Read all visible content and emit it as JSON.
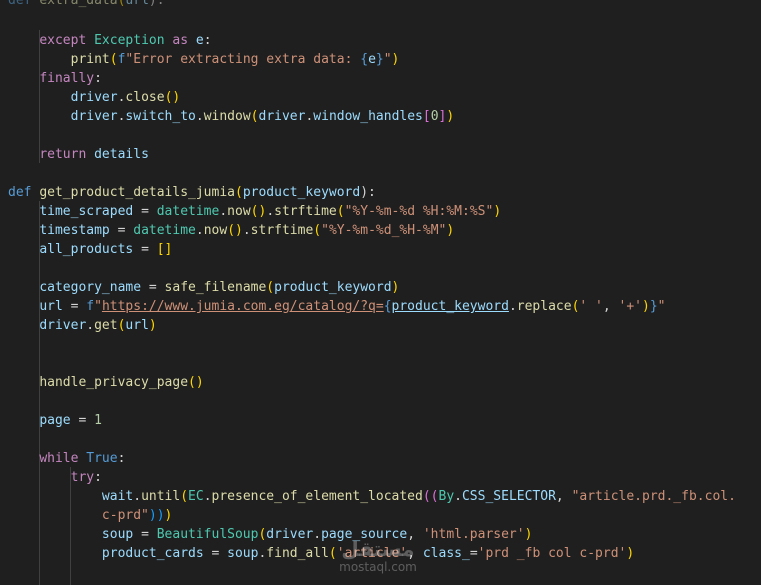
{
  "colors": {
    "background": "#1f1f1f",
    "control_keyword": "#c586c0",
    "keyword": "#569cd6",
    "function": "#dcdcaa",
    "variable": "#9cdcfe",
    "class": "#4ec9b0",
    "string": "#ce9178",
    "number": "#b5cea8"
  },
  "code": {
    "l0": {
      "def": "def",
      "name": "extra_data",
      "param": "url",
      "tail": "):"
    },
    "l2": {
      "except": "except",
      "cls": "Exception",
      "as": "as",
      "var": "e",
      "colon": ":"
    },
    "l3": {
      "fn": "print",
      "pre": "f",
      "str1": "\"Error extracting extra data: ",
      "var": "e",
      "str2": "\""
    },
    "l4": {
      "kw": "finally",
      "colon": ":"
    },
    "l5": {
      "obj": "driver",
      "method": "close"
    },
    "l6": {
      "obj": "driver",
      "attr": "switch_to",
      "method": "window",
      "obj2": "driver",
      "attr2": "window_handles",
      "idx": "0"
    },
    "l8": {
      "kw": "return",
      "var": "details"
    },
    "l10": {
      "def": "def",
      "name": "get_product_details_jumia",
      "param": "product_keyword",
      "tail": "):"
    },
    "l11": {
      "var": "time_scraped",
      "mod": "datetime",
      "fn1": "now",
      "fn2": "strftime",
      "str": "\"%Y-%m-%d %H:%M:%S\""
    },
    "l12": {
      "var": "timestamp",
      "mod": "datetime",
      "fn1": "now",
      "fn2": "strftime",
      "str": "\"%Y-%m-%d_%H-%M\""
    },
    "l13": {
      "var": "all_products",
      "val": "[]"
    },
    "l15": {
      "var": "category_name",
      "fn": "safe_filename",
      "arg": "product_keyword"
    },
    "l16": {
      "var": "url",
      "pre": "f",
      "quote": "\"",
      "link": "https://www.jumia.com.eg/catalog/?q=",
      "arg": "product_keyword",
      "method": "replace",
      "s1": "' '",
      "s2": "'+'",
      "end": "\""
    },
    "l17": {
      "obj": "driver",
      "method": "get",
      "arg": "url"
    },
    "l20": {
      "fn": "handle_privacy_page"
    },
    "l22": {
      "var": "page",
      "num": "1"
    },
    "l24": {
      "kw": "while",
      "val": "True",
      "colon": ":"
    },
    "l25": {
      "kw": "try",
      "colon": ":"
    },
    "l26": {
      "obj": "wait",
      "method": "until",
      "mod": "EC",
      "fn": "presence_of_element_located",
      "cls": "By",
      "const": "CSS_SELECTOR",
      "str": "\"article.prd._fb.col."
    },
    "l27": {
      "str": "c-prd\""
    },
    "l28": {
      "var": "soup",
      "cls": "BeautifulSoup",
      "obj": "driver",
      "attr": "page_source",
      "str": "'html.parser'"
    },
    "l29": {
      "var": "product_cards",
      "obj": "soup",
      "method": "find_all",
      "s1": "'article'",
      "kwarg": "class_",
      "s2": "'prd _fb col c-prd'"
    }
  },
  "watermark": {
    "logo": "مستقل",
    "site": "mostaql.com"
  }
}
